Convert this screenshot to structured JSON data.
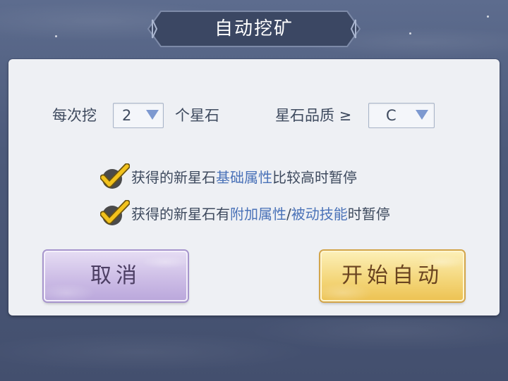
{
  "title": "自动挖矿",
  "settings": {
    "dig_label": "每次挖",
    "dig_count": "2",
    "stone_unit": "个星石",
    "quality_label": "星石品质 ≥",
    "quality_value": "C"
  },
  "options": [
    {
      "checked": true,
      "prefix": "获得的新星石",
      "highlight1": "基础属性",
      "middle": "比较高时暂停",
      "sep": "",
      "highlight2": "",
      "suffix": ""
    },
    {
      "checked": true,
      "prefix": "获得的新星石有",
      "highlight1": "附加属性",
      "middle": "",
      "sep": "/",
      "highlight2": "被动技能",
      "suffix": "时暂停"
    }
  ],
  "buttons": {
    "cancel": "取消",
    "start": "开始自动"
  },
  "colors": {
    "highlight": "#4a72b8",
    "check": "#f2c21c"
  }
}
